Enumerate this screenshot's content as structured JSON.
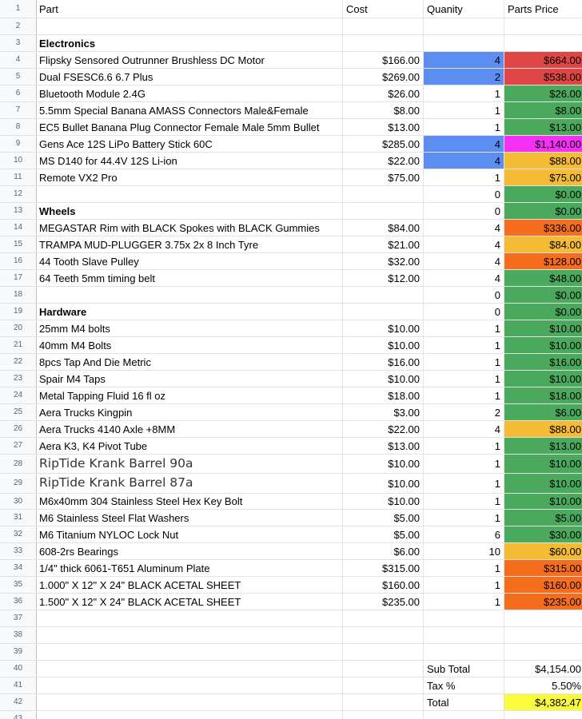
{
  "colors": {
    "blue": "#5b8ef0",
    "red": "#e04545",
    "green": "#4aa95c",
    "magenta": "#f330f3",
    "amber": "#f4bb35",
    "orange": "#f66d1e",
    "yellow": "#fbfb3d"
  },
  "header": {
    "part": "Part",
    "cost": "Cost",
    "quantity": "Quanity",
    "price": "Parts Price"
  },
  "rows": [
    {
      "n": "1",
      "part": "Part",
      "cost": "Cost",
      "qty": "Quanity",
      "price": "Parts Price"
    },
    {
      "n": "2",
      "part": "",
      "cost": "",
      "qty": "",
      "price": ""
    },
    {
      "n": "3",
      "part": "Electronics",
      "cost": "",
      "qty": "",
      "price": "",
      "bold": true
    },
    {
      "n": "4",
      "part": "Flipsky Sensored Outrunner Brushless DC Motor",
      "cost": "$166.00",
      "qty": "4",
      "price": "$664.00",
      "qtyColor": "blue",
      "priceColor": "red"
    },
    {
      "n": "5",
      "part": "Dual FSESC6.6 6.7 Plus",
      "cost": "$269.00",
      "qty": "2",
      "price": "$538.00",
      "qtyColor": "blue",
      "priceColor": "red"
    },
    {
      "n": "6",
      "part": "Bluetooth Module 2.4G",
      "cost": "$26.00",
      "qty": "1",
      "price": "$26.00",
      "priceColor": "green"
    },
    {
      "n": "7",
      "part": "5.5mm Special Banana AMASS Connectors Male&Female",
      "cost": "$8.00",
      "qty": "1",
      "price": "$8.00",
      "priceColor": "green"
    },
    {
      "n": "8",
      "part": "EC5 Bullet Banana Plug Connector Female Male 5mm Bullet",
      "cost": "$13.00",
      "qty": "1",
      "price": "$13.00",
      "priceColor": "green"
    },
    {
      "n": "9",
      "part": "Gens Ace 12S LiPo Battery Stick 60C",
      "cost": "$285.00",
      "qty": "4",
      "price": "$1,140.00",
      "qtyColor": "blue",
      "priceColor": "magenta"
    },
    {
      "n": "10",
      "part": "MS D140 for 44.4V 12S Li-ion",
      "cost": "$22.00",
      "qty": "4",
      "price": "$88.00",
      "qtyColor": "blue",
      "priceColor": "amber"
    },
    {
      "n": "11",
      "part": "Remote VX2 Pro",
      "cost": "$75.00",
      "qty": "1",
      "price": "$75.00",
      "priceColor": "amber"
    },
    {
      "n": "12",
      "part": "",
      "cost": "",
      "qty": "0",
      "price": "$0.00",
      "priceColor": "green"
    },
    {
      "n": "13",
      "part": "Wheels",
      "cost": "",
      "qty": "0",
      "price": "$0.00",
      "priceColor": "green",
      "bold": true
    },
    {
      "n": "14",
      "part": "MEGASTAR Rim with BLACK Spokes with BLACK Gummies",
      "cost": "$84.00",
      "qty": "4",
      "price": "$336.00",
      "priceColor": "orange"
    },
    {
      "n": "15",
      "part": "TRAMPA MUD-PLUGGER 3.75x 2x 8 Inch Tyre",
      "cost": "$21.00",
      "qty": "4",
      "price": "$84.00",
      "priceColor": "amber"
    },
    {
      "n": "16",
      "part": "44 Tooth Slave Pulley",
      "cost": "$32.00",
      "qty": "4",
      "price": "$128.00",
      "priceColor": "orange"
    },
    {
      "n": "17",
      "part": " 64 Teeth 5mm timing belt",
      "cost": "$12.00",
      "qty": "4",
      "price": "$48.00",
      "priceColor": "green"
    },
    {
      "n": "18",
      "part": "",
      "cost": "",
      "qty": "0",
      "price": "$0.00",
      "priceColor": "green"
    },
    {
      "n": "19",
      "part": "Hardware",
      "cost": "",
      "qty": "0",
      "price": "$0.00",
      "priceColor": "green",
      "bold": true
    },
    {
      "n": "20",
      "part": "25mm M4 bolts",
      "cost": "$10.00",
      "qty": "1",
      "price": "$10.00",
      "priceColor": "green"
    },
    {
      "n": "21",
      "part": "40mm M4 Bolts",
      "cost": "$10.00",
      "qty": "1",
      "price": "$10.00",
      "priceColor": "green"
    },
    {
      "n": "22",
      "part": "8pcs Tap And Die Metric",
      "cost": "$16.00",
      "qty": "1",
      "price": "$16.00",
      "priceColor": "green"
    },
    {
      "n": "23",
      "part": "Spair M4 Taps",
      "cost": "$10.00",
      "qty": "1",
      "price": "$10.00",
      "priceColor": "green"
    },
    {
      "n": "24",
      "part": " Metal Tapping Fluid 16 fl oz",
      "cost": "$18.00",
      "qty": "1",
      "price": "$18.00",
      "priceColor": "green"
    },
    {
      "n": "25",
      "part": "Aera Trucks Kingpin",
      "cost": "$3.00",
      "qty": "2",
      "price": "$6.00",
      "priceColor": "green"
    },
    {
      "n": "26",
      "part": "Aera Trucks 4140 Axle +8MM",
      "cost": "$22.00",
      "qty": "4",
      "price": "$88.00",
      "priceColor": "amber"
    },
    {
      "n": "27",
      "part": "Aera K3, K4 Pivot Tube",
      "cost": "$13.00",
      "qty": "1",
      "price": "$13.00",
      "priceColor": "green"
    },
    {
      "n": "28",
      "part": "RipTide Krank Barrel 90a",
      "cost": "$10.00",
      "qty": "1",
      "price": "$10.00",
      "priceColor": "green",
      "large": true
    },
    {
      "n": "29",
      "part": "RipTide Krank Barrel 87a",
      "cost": "$10.00",
      "qty": "1",
      "price": "$10.00",
      "priceColor": "green",
      "large": true
    },
    {
      "n": "30",
      "part": "M6x40mm 304 Stainless Steel Hex Key Bolt",
      "cost": "$10.00",
      "qty": "1",
      "price": "$10.00",
      "priceColor": "green"
    },
    {
      "n": "31",
      "part": "M6 Stainless Steel Flat Washers",
      "cost": "$5.00",
      "qty": "1",
      "price": "$5.00",
      "priceColor": "green"
    },
    {
      "n": "32",
      "part": "M6 Titanium NYLOC Lock Nut",
      "cost": "$5.00",
      "qty": "6",
      "price": "$30.00",
      "priceColor": "green"
    },
    {
      "n": "33",
      "part": " 608-2rs Bearings",
      "cost": "$6.00",
      "qty": "10",
      "price": "$60.00",
      "priceColor": "amber"
    },
    {
      "n": "34",
      "part": "1/4\" thick 6061-T651 Aluminum Plate",
      "cost": "$315.00",
      "qty": "1",
      "price": "$315.00",
      "priceColor": "orange"
    },
    {
      "n": "35",
      "part": "1.000\" X 12\" X 24\" BLACK ACETAL SHEET",
      "cost": "$160.00",
      "qty": "1",
      "price": "$160.00",
      "priceColor": "orange"
    },
    {
      "n": "36",
      "part": "1.500\" X 12\" X 24\" BLACK ACETAL SHEET",
      "cost": "$235.00",
      "qty": "1",
      "price": "$235.00",
      "priceColor": "orange"
    },
    {
      "n": "37",
      "part": "",
      "cost": "",
      "qty": "",
      "price": ""
    },
    {
      "n": "38",
      "part": "",
      "cost": "",
      "qty": "",
      "price": ""
    },
    {
      "n": "39",
      "part": "",
      "cost": "",
      "qty": "",
      "price": ""
    },
    {
      "n": "40",
      "part": "",
      "cost": "",
      "qty": "Sub Total",
      "price": "$4,154.00",
      "qtyLeft": true
    },
    {
      "n": "41",
      "part": "",
      "cost": "",
      "qty": "Tax %",
      "price": "5.50%",
      "qtyLeft": true
    },
    {
      "n": "42",
      "part": "",
      "cost": "",
      "qty": "Total",
      "price": "$4,382.47",
      "qtyLeft": true,
      "priceColor": "yellow"
    },
    {
      "n": "43",
      "part": "",
      "cost": "",
      "qty": "",
      "price": ""
    }
  ]
}
